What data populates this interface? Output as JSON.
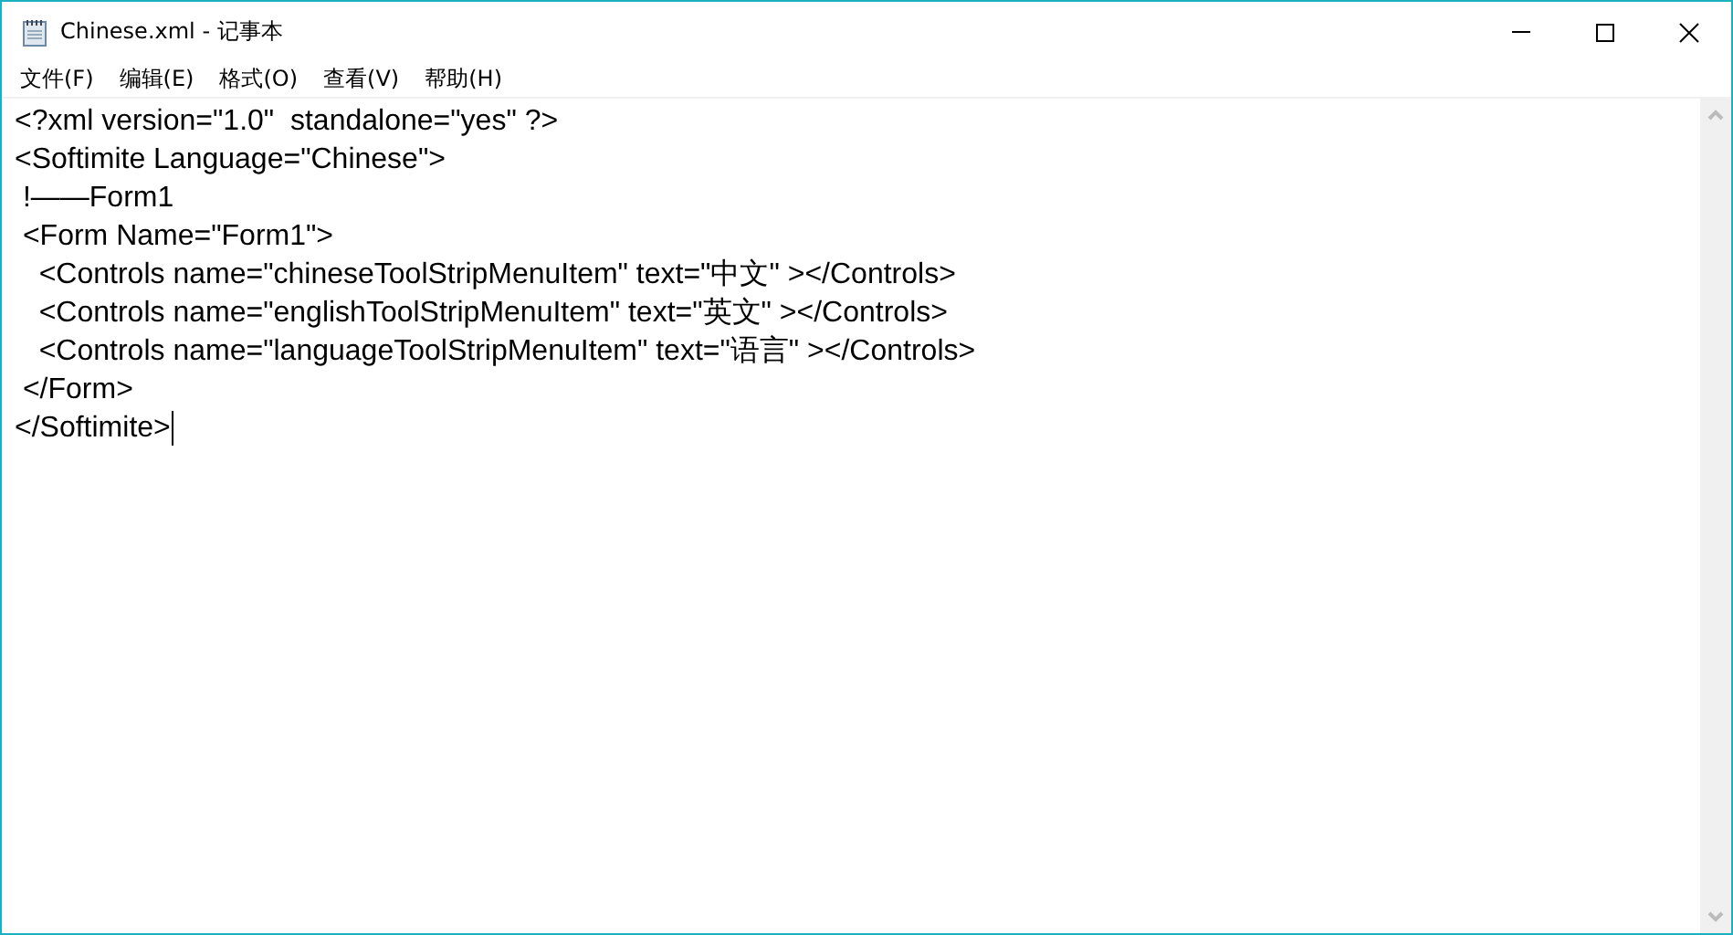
{
  "window": {
    "title": "Chinese.xml - 记事本"
  },
  "menu": [
    "文件(F)",
    "编辑(E)",
    "格式(O)",
    "查看(V)",
    "帮助(H)"
  ],
  "editor": {
    "lines": [
      "<?xml version=\"1.0\"  standalone=\"yes\" ?>",
      "<Softimite Language=\"Chinese\">",
      " !——Form1",
      " <Form Name=\"Form1\">",
      "   <Controls name=\"chineseToolStripMenuItem\" text=\"中文\" ></Controls>",
      "   <Controls name=\"englishToolStripMenuItem\" text=\"英文\" ></Controls>",
      "   <Controls name=\"languageToolStripMenuItem\" text=\"语言\" ></Controls>",
      " </Form>",
      "</Softimite>"
    ]
  }
}
